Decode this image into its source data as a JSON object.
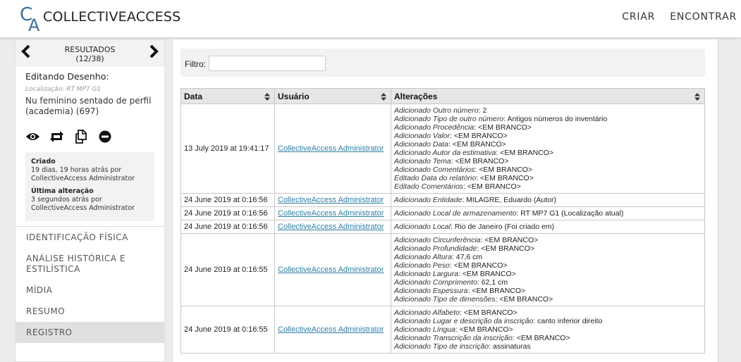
{
  "header": {
    "logo_c": "C",
    "logo_a": "A",
    "brand": "COLLECTIVEACCESS",
    "nav": [
      "CRIAR",
      "ENCONTRAR"
    ]
  },
  "left": {
    "results_label": "RESULTADOS",
    "results_count": "(12/38)",
    "editing_title": "Editando Desenho:",
    "location": "Localização: RT MP7 G1",
    "object_name": "Nu feminino sentado de perfil (academia) (697)",
    "created_label": "Criado",
    "created_value": "19 dias, 19 horas atrás por CollectiveAccess Administrator",
    "modified_label": "Última alteração",
    "modified_value": "3 segundos atrás por CollectiveAccess Administrator",
    "icons": [
      "eye-icon",
      "swap-icon",
      "duplicate-icon",
      "delete-icon"
    ],
    "nav": [
      "IDENTIFICAÇÃO FÍSICA",
      "ANÁLISE HISTÓRICA E ESTILÍSTICA",
      "MÍDIA",
      "RESUMO",
      "REGISTRO"
    ],
    "active_nav": "REGISTRO"
  },
  "main": {
    "filter_label": "Filtro:",
    "filter_value": "",
    "columns": [
      "Data",
      "Usuário",
      "Alterações"
    ],
    "rows": [
      {
        "date": "13 July 2019 at 19:41:17",
        "user": "CollectiveAccess Administrator",
        "changes": [
          {
            "field": "Adicionado Outro número",
            "value": "2"
          },
          {
            "field": "Adicionado Tipo de outro número",
            "value": "Antigos números do inventário"
          },
          {
            "field": "Adicionado Procedência",
            "value": "<EM BRANCO>"
          },
          {
            "field": "Adicionado Valor",
            "value": "<EM BRANCO>"
          },
          {
            "field": "Adicionado Data",
            "value": "<EM BRANCO>"
          },
          {
            "field": "Adicionado Autor da estimativa",
            "value": "<EM BRANCO>"
          },
          {
            "field": "Adicionado Tema",
            "value": "<EM BRANCO>"
          },
          {
            "field": "Adicionado Comentários",
            "value": "<EM BRANCO>"
          },
          {
            "field": "Editado Data do relatório",
            "value": "<EM BRANCO>"
          },
          {
            "field": "Editado Comentários",
            "value": "<EM BRANCO>"
          }
        ]
      },
      {
        "date": "24 June 2019 at 0:16:56",
        "user": "CollectiveAccess Administrator",
        "changes": [
          {
            "field": "Adicionado Entidade",
            "value": "MILAGRE, Eduardo (Autor)"
          }
        ]
      },
      {
        "date": "24 June 2019 at 0:16:56",
        "user": "CollectiveAccess Administrator",
        "changes": [
          {
            "field": "Adicionado Local de armazenamento",
            "value": "RT MP7 G1 (Localização atual)"
          }
        ]
      },
      {
        "date": "24 June 2019 at 0:16:56",
        "user": "CollectiveAccess Administrator",
        "changes": [
          {
            "field": "Adicionado Local",
            "value": "Rio de Janeiro (Foi criado em)"
          }
        ]
      },
      {
        "date": "24 June 2019 at 0:16:55",
        "user": "CollectiveAccess Administrator",
        "changes": [
          {
            "field": "Adicionado Circunferência",
            "value": "<EM BRANCO>"
          },
          {
            "field": "Adicionado Profundidade",
            "value": "<EM BRANCO>"
          },
          {
            "field": "Adicionado Altura",
            "value": "47,6 cm"
          },
          {
            "field": "Adicionado Peso",
            "value": "<EM BRANCO>"
          },
          {
            "field": "Adicionado Largura",
            "value": "<EM BRANCO>"
          },
          {
            "field": "Adicionado Comprimento",
            "value": "62,1 cm"
          },
          {
            "field": "Adicionado Espessura",
            "value": "<EM BRANCO>"
          },
          {
            "field": "Adicionado Tipo de dimensões",
            "value": "<EM BRANCO>"
          }
        ]
      },
      {
        "date": "24 June 2019 at 0:16:55",
        "user": "CollectiveAccess Administrator",
        "changes": [
          {
            "field": "Adicionado Alfabeto",
            "value": "<EM BRANCO>"
          },
          {
            "field": "Adicionado Lugar e descrição da inscrição",
            "value": "canto inferior direito"
          },
          {
            "field": "Adicionado Língua",
            "value": "<EM BRANCO>"
          },
          {
            "field": "Adicionado Transcrição da inscrição",
            "value": "<EM BRANCO>"
          },
          {
            "field": "Adicionado Tipo de inscrição",
            "value": "assinaturas"
          }
        ]
      }
    ]
  }
}
